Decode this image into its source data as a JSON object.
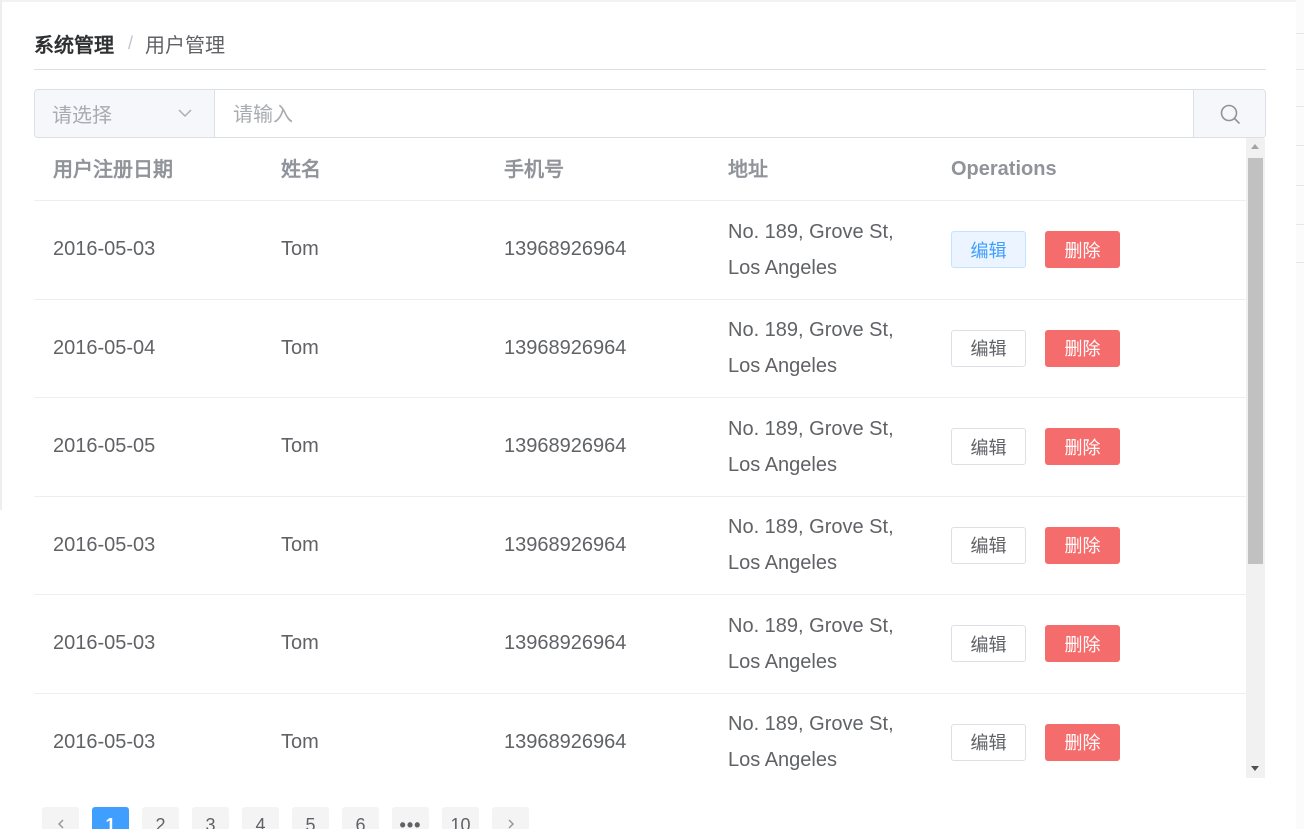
{
  "breadcrumb": {
    "items": [
      "系统管理",
      "用户管理"
    ],
    "separator": "/"
  },
  "search": {
    "select_placeholder": "请选择",
    "input_placeholder": "请输入"
  },
  "table": {
    "headers": [
      "用户注册日期",
      "姓名",
      "手机号",
      "地址",
      "Operations"
    ],
    "rows": [
      {
        "date": "2016-05-03",
        "name": "Tom",
        "phone": "13968926964",
        "address": "No. 189, Grove St, Los Angeles"
      },
      {
        "date": "2016-05-04",
        "name": "Tom",
        "phone": "13968926964",
        "address": "No. 189, Grove St, Los Angeles"
      },
      {
        "date": "2016-05-05",
        "name": "Tom",
        "phone": "13968926964",
        "address": "No. 189, Grove St, Los Angeles"
      },
      {
        "date": "2016-05-03",
        "name": "Tom",
        "phone": "13968926964",
        "address": "No. 189, Grove St, Los Angeles"
      },
      {
        "date": "2016-05-03",
        "name": "Tom",
        "phone": "13968926964",
        "address": "No. 189, Grove St, Los Angeles"
      },
      {
        "date": "2016-05-03",
        "name": "Tom",
        "phone": "13968926964",
        "address": "No. 189, Grove St, Los Angeles"
      }
    ],
    "edit_label": "编辑",
    "delete_label": "删除"
  },
  "pagination": {
    "pages": [
      "1",
      "2",
      "3",
      "4",
      "5",
      "6",
      "•••",
      "10"
    ],
    "current": "1"
  },
  "colors": {
    "primary": "#409eff",
    "danger": "#f56c6c",
    "header_text": "#909399",
    "body_text": "#606266"
  }
}
